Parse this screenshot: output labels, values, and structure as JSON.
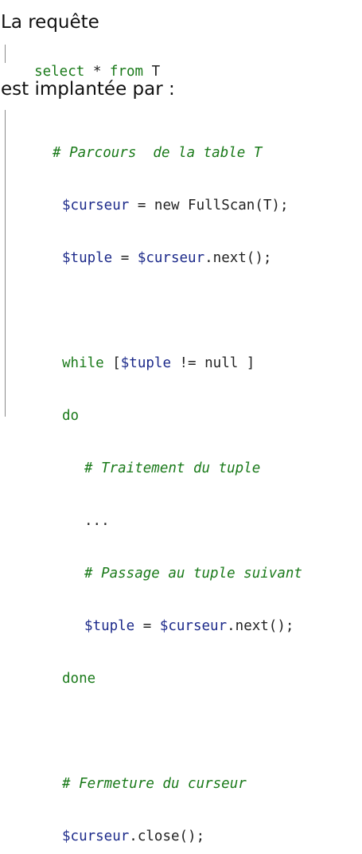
{
  "intro": "La requête",
  "query": {
    "kw1": "select",
    "star": " * ",
    "kw2": "from",
    "table": " T"
  },
  "middle": "est implantée par :",
  "code": {
    "c1": "# Parcours  de la table T",
    "l2_var": "$curseur",
    "l2_rest": " = new FullScan(T);",
    "l3_var": "$tuple",
    "l3_mid": " = ",
    "l3_var2": "$curseur",
    "l3_rest": ".next();",
    "l5_kw": "while",
    "l5_a": " [",
    "l5_var": "$tuple",
    "l5_rest": " != null ]",
    "l6_kw": "do",
    "c7": "# Traitement du tuple",
    "l8": "...",
    "c9": "# Passage au tuple suivant",
    "l10_var": "$tuple",
    "l10_mid": " = ",
    "l10_var2": "$curseur",
    "l10_rest": ".next();",
    "l11_kw": "done",
    "c13": "# Fermeture du curseur",
    "l14_var": "$curseur",
    "l14_rest": ".close();"
  }
}
